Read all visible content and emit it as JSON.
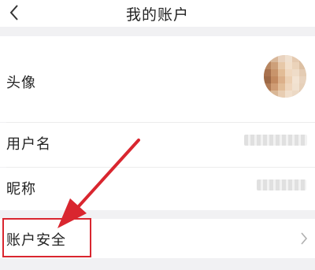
{
  "header": {
    "title": "我的账户",
    "back_icon": "chevron-left-icon"
  },
  "rows": [
    {
      "label": "头像"
    },
    {
      "label": "用户名"
    },
    {
      "label": "昵称"
    },
    {
      "label": "账户安全"
    }
  ],
  "colors": {
    "background": "#f1f1f3",
    "annotation": "#d9262f"
  }
}
